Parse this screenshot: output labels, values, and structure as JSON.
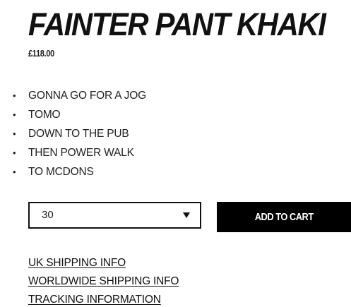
{
  "product": {
    "title": "FAINTER PANT KHAKI",
    "price": "£118.00"
  },
  "features": [
    "GONNA GO FOR A JOG",
    "TOMO",
    "DOWN TO THE PUB",
    "THEN POWER WALK",
    "TO MCDONS"
  ],
  "size_select": {
    "selected_value": "30",
    "caret_icon": "caret-down-icon"
  },
  "cart": {
    "button_label": "ADD TO CART",
    "button_bg": "#000000",
    "button_text_color": "#ffffff"
  },
  "links": [
    "UK SHIPPING INFO",
    "WORLDWIDE SHIPPING INFO",
    "TRACKING INFORMATION"
  ]
}
